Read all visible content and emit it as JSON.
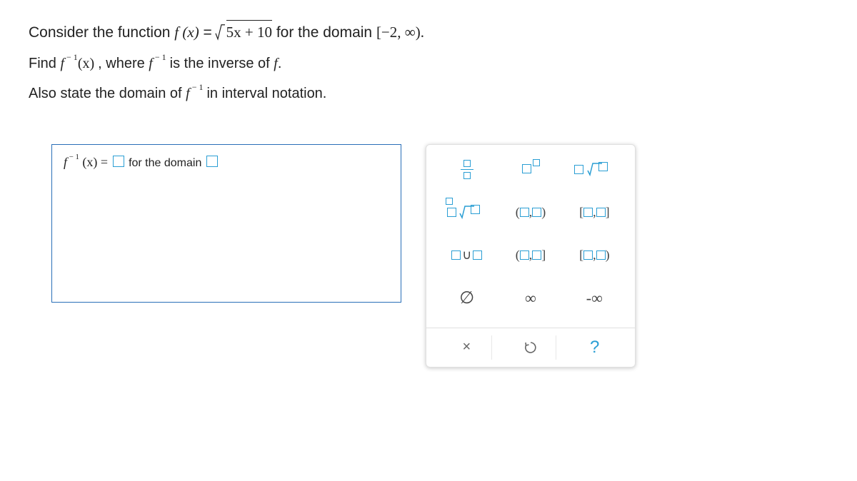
{
  "problem": {
    "line1_pre": "Consider the function ",
    "fx": "f (x)",
    "eq": "=",
    "radicand": "5x + 10",
    "line1_mid": " for the domain ",
    "domain_original": "[−2, ∞).",
    "line2_pre": "Find ",
    "finv": "f",
    "finv_exp": " − 1",
    "finv_arg": "(x)",
    "line2_mid": ", where ",
    "line2_post": " is the inverse of ",
    "f_of": "f",
    "period": ".",
    "line3_pre": "Also state the domain of ",
    "line3_post": " in interval notation."
  },
  "answer": {
    "lhs_f": "f",
    "lhs_exp": " − 1",
    "lhs_arg": " (x) ",
    "eq": " = ",
    "for_the_domain": " for  the  domain  "
  },
  "palette": {
    "open_interval": "(□,□)",
    "closed_interval": "[□,□]",
    "half_open1": "(□,□]",
    "half_open2": "[□,□)",
    "union": "□∪□",
    "empty": "∅",
    "infty": "∞",
    "neg_infty": "-∞",
    "close": "×",
    "reset": "↺",
    "help": "?"
  }
}
